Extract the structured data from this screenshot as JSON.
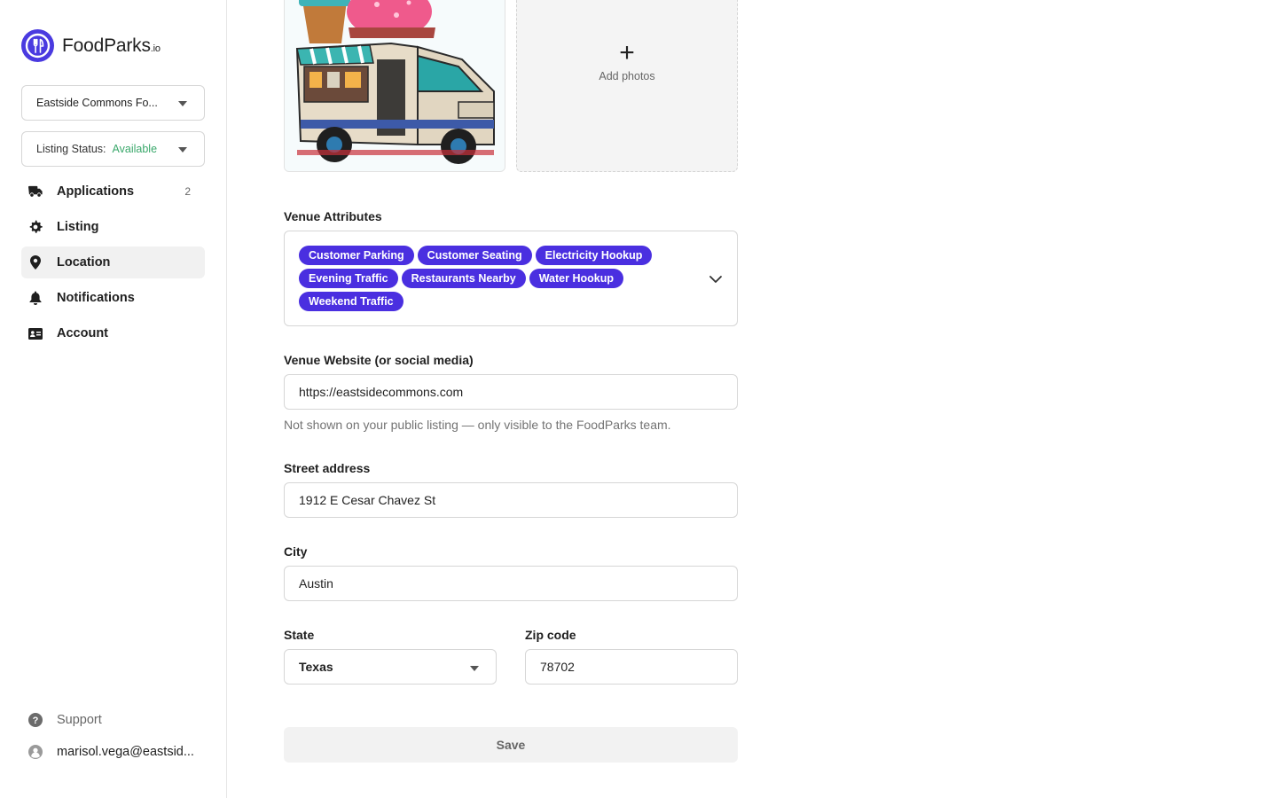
{
  "brand": {
    "name": "FoodParks",
    "suffix": ".io",
    "accent": "#4a3ae0"
  },
  "sidebar": {
    "venue_select": {
      "value": "Eastside Commons Fo..."
    },
    "listing_status": {
      "label": "Listing Status:",
      "value": "Available",
      "value_color": "#3aa86b"
    },
    "items": [
      {
        "label": "Applications",
        "icon": "truck-icon",
        "count": "2"
      },
      {
        "label": "Listing",
        "icon": "gear-icon"
      },
      {
        "label": "Location",
        "icon": "map-pin-icon",
        "active": true
      },
      {
        "label": "Notifications",
        "icon": "bell-icon"
      },
      {
        "label": "Account",
        "icon": "id-card-icon"
      }
    ],
    "support": {
      "label": "Support",
      "icon": "help-circle-icon"
    },
    "user": {
      "email": "marisol.vega@eastsid...",
      "icon": "user-avatar-icon"
    }
  },
  "photos": {
    "add_label": "Add photos",
    "plus": "+"
  },
  "venue_attributes": {
    "label": "Venue Attributes",
    "tags": [
      "Customer Parking",
      "Customer Seating",
      "Electricity Hookup",
      "Evening Traffic",
      "Restaurants Nearby",
      "Water Hookup",
      "Weekend Traffic"
    ],
    "tag_color": "#4a2fe0"
  },
  "website": {
    "label": "Venue Website (or social media)",
    "value": "https://eastsidecommons.com",
    "helper": "Not shown on your public listing — only visible to the FoodParks team."
  },
  "street": {
    "label": "Street address",
    "value": "1912 E Cesar Chavez St"
  },
  "city": {
    "label": "City",
    "value": "Austin"
  },
  "state": {
    "label": "State",
    "value": "Texas"
  },
  "zip": {
    "label": "Zip code",
    "value": "78702"
  },
  "save_label": "Save"
}
